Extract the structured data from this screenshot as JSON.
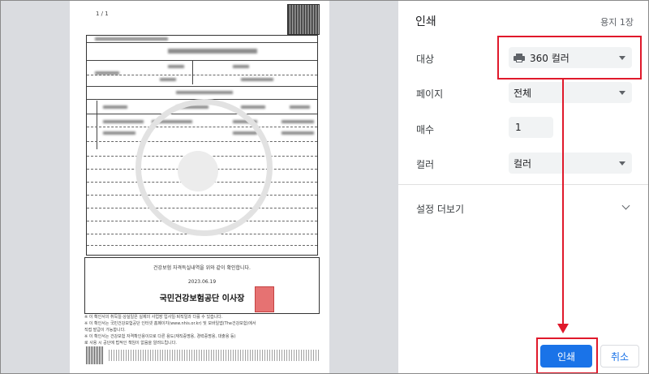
{
  "preview": {
    "page_number": "1 / 1",
    "confirm_text": "건강보험 자격득실내역을 위와 같이 확인합니다.",
    "confirm_date": "2023.06.19",
    "issuer": "국민건강보험공단 이사장",
    "notes": [
      "※ 이 확인서의 취득일·상실일은 실제의 사업장 입사일·퇴직일과 다를 수 있습니다.",
      "※ 이 확인서는 국민건강보험공단 인터넷 홈페이지(www.nhis.or.kr) 및 모바일앱(The건강보험)에서",
      "   직접 발급이 가능합니다.",
      "※ 이 확인서는 건강보험 자격확인용이므로 다른 용도(재직증명용, 경력증명용, 대출용 등)",
      "   로 사용 시 공단에 법적인 책임이 없음을 알려드립니다."
    ]
  },
  "settings": {
    "title": "인쇄",
    "sheet_count": "용지 1장",
    "destination": {
      "label": "대상",
      "value": "360 컬러",
      "icon": "printer-icon"
    },
    "pages": {
      "label": "페이지",
      "value": "전체"
    },
    "copies": {
      "label": "매수",
      "value": "1"
    },
    "color": {
      "label": "컬러",
      "value": "컬러"
    },
    "more_settings": "설정 더보기",
    "print_button": "인쇄",
    "cancel_button": "취소"
  },
  "colors": {
    "accent": "#1a73e8",
    "annotation": "#e0192b",
    "preview_bg": "#dadce0"
  }
}
